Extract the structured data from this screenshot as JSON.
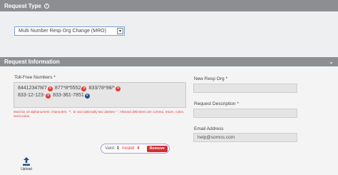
{
  "request_type": {
    "header": "Request Type",
    "selected": "Multi Number Resp Org Change (MRO)"
  },
  "request_info": {
    "header": "Request Information",
    "tfn_label": "Toll-Free Numbers *",
    "numbers": [
      {
        "value": "844123478/7",
        "status": "invalid"
      },
      {
        "value": "877*8*5552",
        "status": "invalid"
      },
      {
        "value": "833/78*98/*",
        "status": "invalid"
      },
      {
        "value": "833-12-123-",
        "status": "invalid"
      },
      {
        "value": "833-361-7851",
        "status": "valid"
      }
    ],
    "hint": "Must be 10 alphanumeric characters, '*', '&' and optionally two dashes '-'. Allowed delimiters are comma, return, colon, semi-colon.",
    "valid_label": "Valid:",
    "valid_count": "1",
    "invalid_label": "Invalid:",
    "invalid_count": "4",
    "remove_label": "Remove",
    "new_resp_org_label": "New Resp Org *",
    "new_resp_org_value": "",
    "description_label": "Request Description *",
    "description_value": "",
    "email_label": "Email Address",
    "email_value": "help@somos.com",
    "upload_label": "Upload"
  },
  "icons": {
    "info": "info-icon",
    "collapse": "chevron-down-icon",
    "remove_chip": "close-icon",
    "upload": "upload-icon"
  },
  "colors": {
    "header_bar": "#8c8f92",
    "invalid": "#e53935",
    "valid_chip": "#1f4f8f",
    "remove_button": "#d32f2f"
  }
}
